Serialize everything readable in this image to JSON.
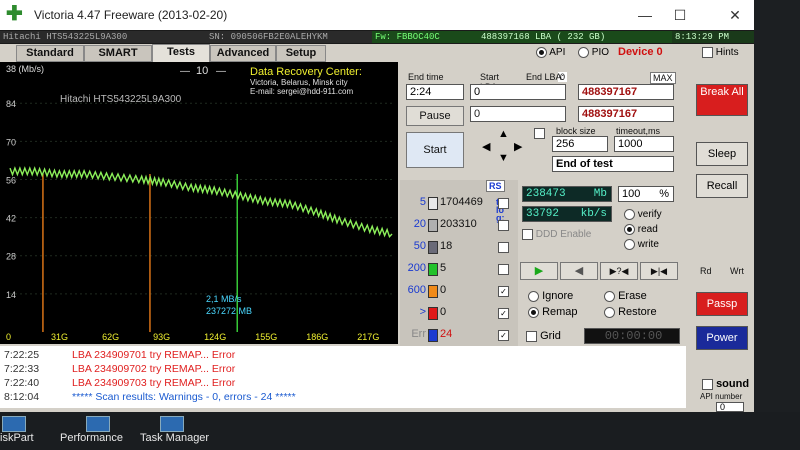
{
  "window": {
    "title": "Victoria 4.47  Freeware (2013-02-20)",
    "minimize": "—",
    "maximize": "☐",
    "close": "✕"
  },
  "infobar": {
    "model": "Hitachi HTS543225L9A300",
    "serial": "SN: 090506FB2E0ALEHYKM",
    "firmware": "Fw: FBBOC40C",
    "lba": "488397168 LBA ( 232 GB)",
    "clock": "8:13:29 PM"
  },
  "tabs": [
    "Standard",
    "SMART",
    "Tests",
    "Advanced",
    "Setup"
  ],
  "mode": {
    "api": "API",
    "pio": "PIO",
    "device": "Device 0",
    "hints": "Hints"
  },
  "graph": {
    "unit": "38 (Mb/s)",
    "scale_value": "10",
    "model": "Hitachi HTS543225L9A300",
    "center_title": "Data Recovery Center:",
    "center_city": "Victoria, Belarus, Minsk city",
    "center_email": "E-mail: sergei@hdd-911.com",
    "speed_readout": "2,1 MB/s",
    "mb_readout": "237272 MB",
    "y_ticks": [
      "84",
      "70",
      "56",
      "42",
      "28",
      "14"
    ],
    "x_ticks": [
      "0",
      "31G",
      "62G",
      "93G",
      "124G",
      "155G",
      "186G",
      "217G"
    ]
  },
  "chart_data": {
    "type": "line",
    "xlabel": "",
    "ylabel": "38 (Mb/s)",
    "xlim": [
      0,
      232
    ],
    "ylim": [
      0,
      94
    ],
    "x_tick_labels": [
      "0",
      "31G",
      "62G",
      "93G",
      "124G",
      "155G",
      "186G",
      "217G"
    ],
    "y_tick_labels": [
      "14",
      "28",
      "42",
      "56",
      "70",
      "84"
    ],
    "series": [
      {
        "x": [
          0,
          15,
          30,
          45,
          62,
          80,
          93,
          110,
          124,
          140,
          155,
          170,
          186,
          200,
          217,
          232
        ],
        "y": [
          59,
          59,
          58,
          58,
          57,
          56,
          55,
          53,
          52,
          50,
          48,
          47,
          44,
          41,
          38,
          36
        ]
      }
    ],
    "spikes_x": [
      20,
      85,
      138
    ]
  },
  "controls": {
    "end_time_label": "End time",
    "end_time_value": "2:24",
    "start_lba_label": "Start LBA:",
    "start_lba_zero": "0",
    "start_lba_value": "0",
    "start_lba_value2": "0",
    "end_lba_label": "End LBA:",
    "end_lba_max": "MAX",
    "end_lba_value": "488397167",
    "end_lba_value2": "488397167",
    "pause": "Pause",
    "start": "Start",
    "block_size_label": "block size",
    "block_size_value": "256",
    "timeout_label": "timeout,ms",
    "timeout_value": "1000",
    "end_action": "End of test"
  },
  "counts": {
    "rs": "RS",
    "to_log": "to log:",
    "rows": [
      {
        "label": "5",
        "value": "1704469",
        "color": "#e8e8e8"
      },
      {
        "label": "20",
        "value": "203310",
        "color": "#b0b0b0"
      },
      {
        "label": "50",
        "value": "18",
        "color": "#6a6a78"
      },
      {
        "label": "200",
        "value": "5",
        "color": "#22c22a"
      },
      {
        "label": "600",
        "value": "0",
        "color": "#f08a18"
      },
      {
        "label": ">",
        "value": "0",
        "color": "#e01a1a"
      },
      {
        "label": "Err",
        "value": "24",
        "color": "#1a3ad0"
      }
    ]
  },
  "stats": {
    "mb": "238473",
    "mb_unit": "Mb",
    "percent": "100",
    "percent_unit": "%",
    "speed": "33792",
    "speed_unit": "kb/s",
    "ddd": "DDD Enable"
  },
  "modes": {
    "verify": "verify",
    "read": "read",
    "write": "write"
  },
  "actions": {
    "ignore": "Ignore",
    "erase": "Erase",
    "remap": "Remap",
    "restore": "Restore"
  },
  "grid": {
    "label": "Grid",
    "timer": "00:00:00"
  },
  "right": {
    "break": "Break All",
    "sleep": "Sleep",
    "recall": "Recall",
    "rd": "Rd",
    "wrt": "Wrt",
    "passp": "Passp",
    "power": "Power",
    "sound": "sound",
    "api_number_label": "API number",
    "api_number_value": "0"
  },
  "log": [
    {
      "time": "7:22:25",
      "msg": "LBA 234909701 try REMAP... Error",
      "color": "#e02020"
    },
    {
      "time": "7:22:33",
      "msg": "LBA 234909702 try REMAP... Error",
      "color": "#e02020"
    },
    {
      "time": "7:22:40",
      "msg": "LBA 234909703 try REMAP... Error",
      "color": "#e02020"
    },
    {
      "time": "8:12:04",
      "msg": "***** Scan results: Warnings - 0, errors - 24 *****",
      "color": "#1a5ad0"
    }
  ],
  "taskbar": [
    "iskPart",
    "Performance",
    "Task Manager"
  ]
}
